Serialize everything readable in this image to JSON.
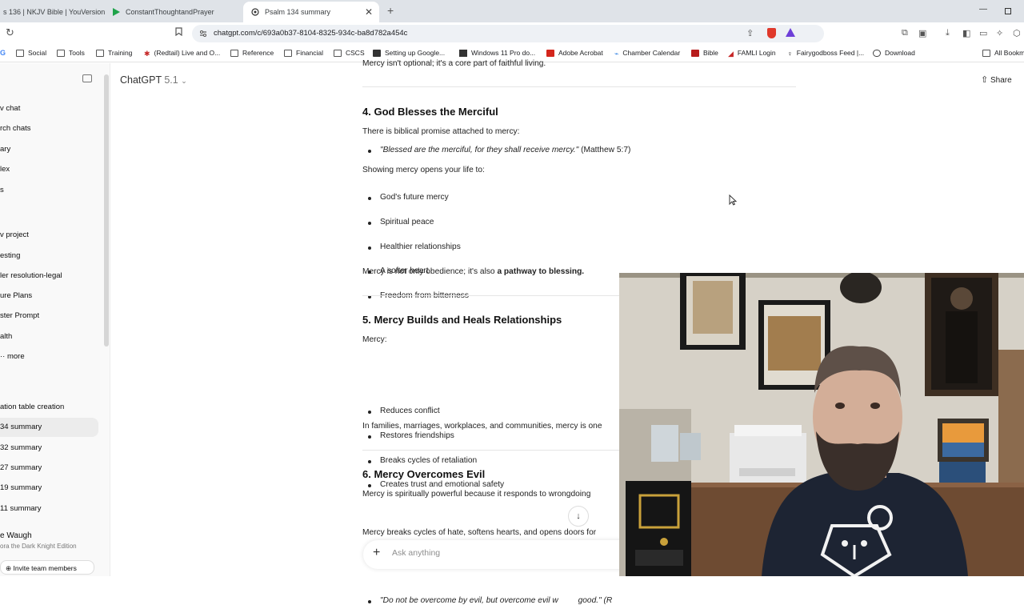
{
  "browser": {
    "tabs": [
      {
        "title": "s 136 | NKJV Bible | YouVersion",
        "active": false
      },
      {
        "title": "ConstantThoughtandPrayer",
        "active": false
      },
      {
        "title": "Psalm 134 summary",
        "active": true
      }
    ],
    "new_tab_symbol": "+",
    "url": "chatgpt.com/c/693a0b37-8104-8325-934c-ba8d782a454c",
    "bookmarks": [
      "Social",
      "Tools",
      "Training",
      "(Redtail) Live and O...",
      "Reference",
      "Financial",
      "CSCS",
      "Setting up Google...",
      "Windows 11 Pro do...",
      "Adobe Acrobat",
      "Chamber Calendar",
      "Bible",
      "FAMLI Login",
      "Fairygodboss Feed |...",
      "Download",
      "All Bookm"
    ]
  },
  "sidebar": {
    "top_items": [
      "v chat",
      "rch chats",
      "ary",
      "lex",
      "s"
    ],
    "project_items": [
      "v project",
      "esting",
      "ler resolution-legal",
      "ure Plans",
      "ster Prompt",
      "alth",
      "more"
    ],
    "chat_items": [
      "ation table creation",
      "34 summary",
      "32 summary",
      "27 summary",
      "19 summary",
      "11 summary"
    ],
    "active_chat_index": 1,
    "user_name": "e Waugh",
    "user_sub": "ora the Dark Knight Edition",
    "invite_label": "Invite team members"
  },
  "header": {
    "model_name": "ChatGPT",
    "model_version": "5.1",
    "share_label": "Share"
  },
  "content": {
    "top_cut_text": "Mercy isn't optional; it's a core part of faithful living.",
    "section4": {
      "heading": "4. God Blesses the Merciful",
      "intro": "There is biblical promise attached to mercy:",
      "quote": "\"Blessed are the merciful, for they shall receive mercy.\"",
      "quote_ref": "(Matthew 5:7)",
      "lead": "Showing mercy opens your life to:",
      "items": [
        "God's future mercy",
        "Spiritual peace",
        "Healthier relationships",
        "A softer heart",
        "Freedom from bitterness"
      ],
      "conclusion_plain": "Mercy is not only obedience; it's also ",
      "conclusion_bold": "a pathway to blessing."
    },
    "section5": {
      "heading": "5. Mercy Builds and Heals Relationships",
      "intro": "Mercy:",
      "items": [
        "Reduces conflict",
        "Restores friendships",
        "Breaks cycles of retaliation",
        "Creates trust and emotional safety"
      ],
      "conclusion": "In families, marriages, workplaces, and communities, mercy is one"
    },
    "section6": {
      "heading": "6. Mercy Overcomes Evil",
      "intro": "Mercy is spiritually powerful because it responds to wrongdoing",
      "quote": "\"Do not be overcome by evil, but overcome evil w",
      "quote_end": "good.\" (R",
      "conclusion": "Mercy breaks cycles of hate, softens hearts, and opens doors for"
    }
  },
  "composer": {
    "placeholder": "Ask anything",
    "plus_symbol": "+",
    "scroll_down_symbol": "↓"
  },
  "colors": {
    "tabstrip": "#dfe3e8",
    "sidebar_bg": "#f9f9f9",
    "active_chat_bg": "#ececec",
    "shirt": "#1d2433",
    "wall": "#d7d2c8"
  }
}
